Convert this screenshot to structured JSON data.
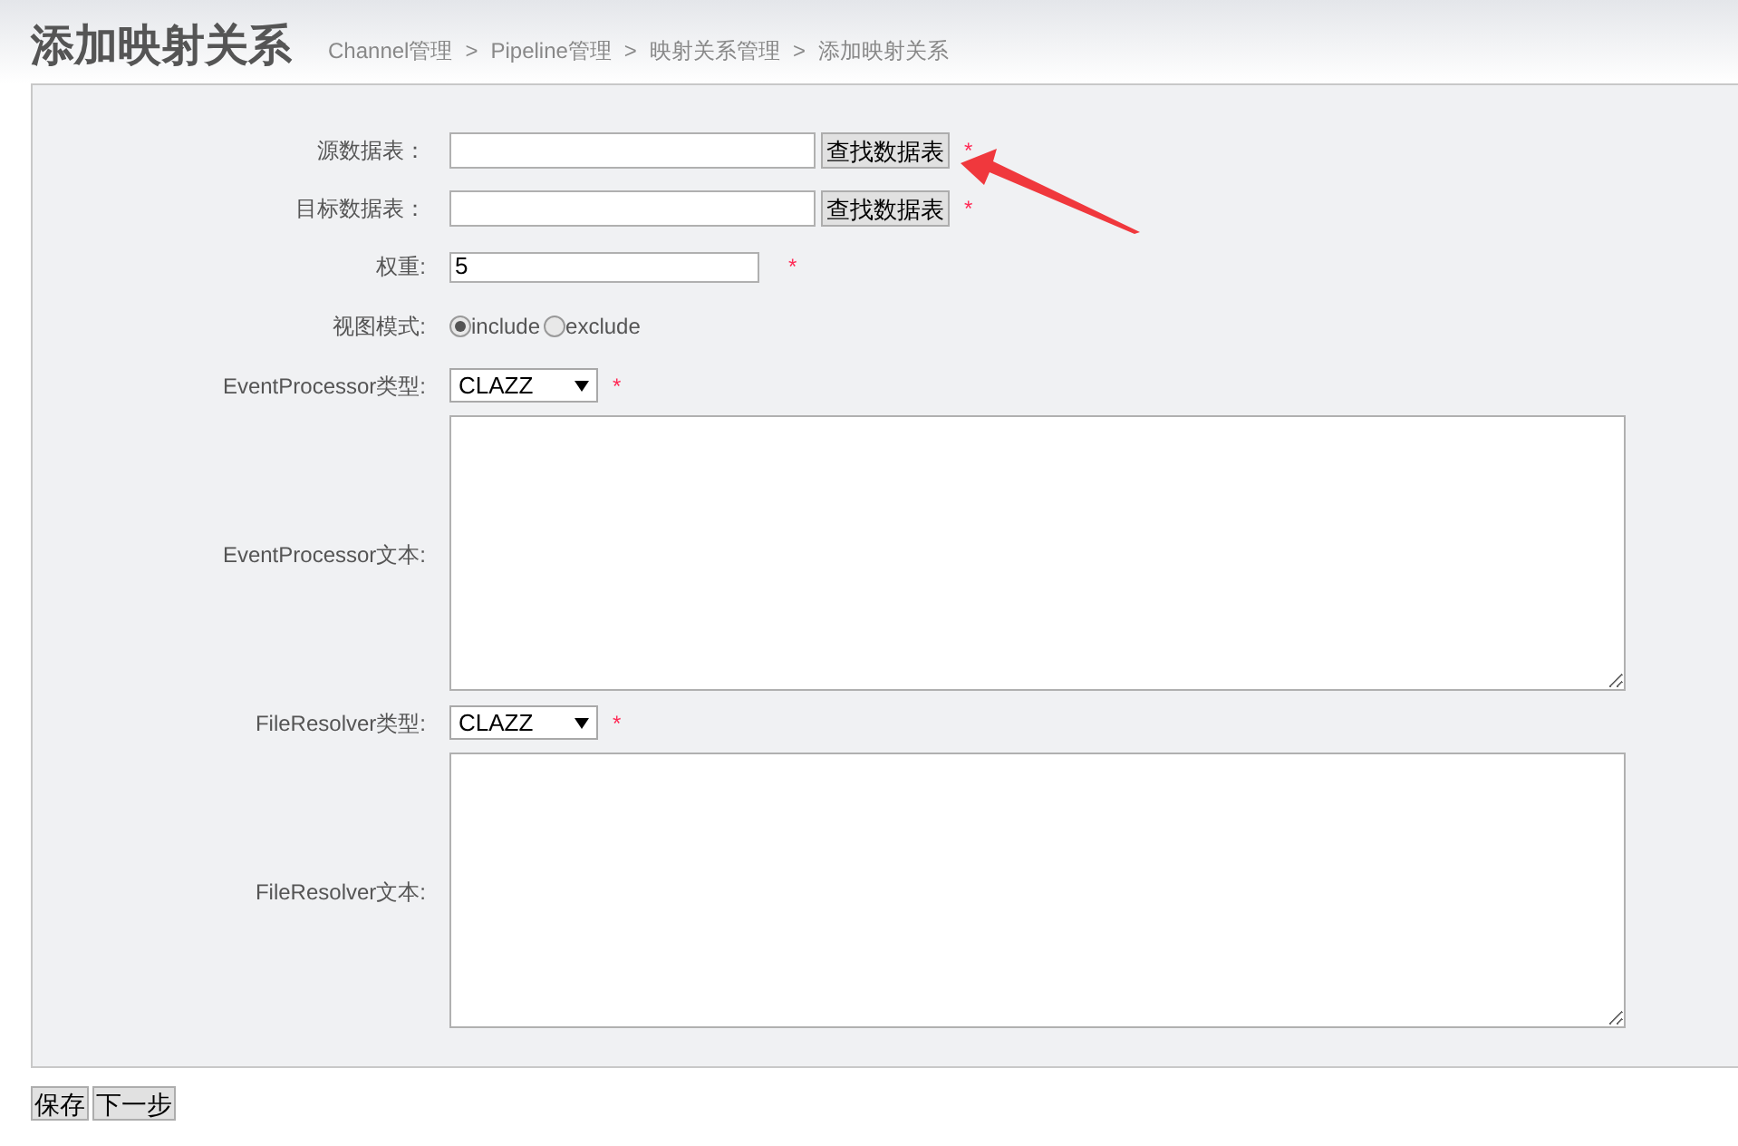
{
  "title": "添加映射关系",
  "breadcrumb": [
    "Channel管理",
    "Pipeline管理",
    "映射关系管理",
    "添加映射关系"
  ],
  "breadcrumb_separator": ">",
  "fields": [
    {
      "kind": "lookup",
      "label": "源数据表：",
      "button": "查找数据表",
      "required": true
    },
    {
      "kind": "lookup",
      "label": "目标数据表：",
      "button": "查找数据表",
      "required": true
    },
    {
      "kind": "text",
      "label": "权重:",
      "value": "5",
      "required": true
    },
    {
      "kind": "radio",
      "label": "视图模式:",
      "options": [
        {
          "label": "include",
          "selected": true
        },
        {
          "label": "exclude",
          "selected": false
        }
      ]
    },
    {
      "kind": "select",
      "label": "EventProcessor类型:",
      "value": "CLAZZ",
      "required": true
    },
    {
      "kind": "textarea",
      "label": "EventProcessor文本:"
    },
    {
      "kind": "select",
      "label": "FileResolver类型:",
      "value": "CLAZZ",
      "required": true
    },
    {
      "kind": "textarea",
      "label": "FileResolver文本:"
    }
  ],
  "required_mark": "*",
  "buttons": [
    "保存",
    "下一步"
  ]
}
